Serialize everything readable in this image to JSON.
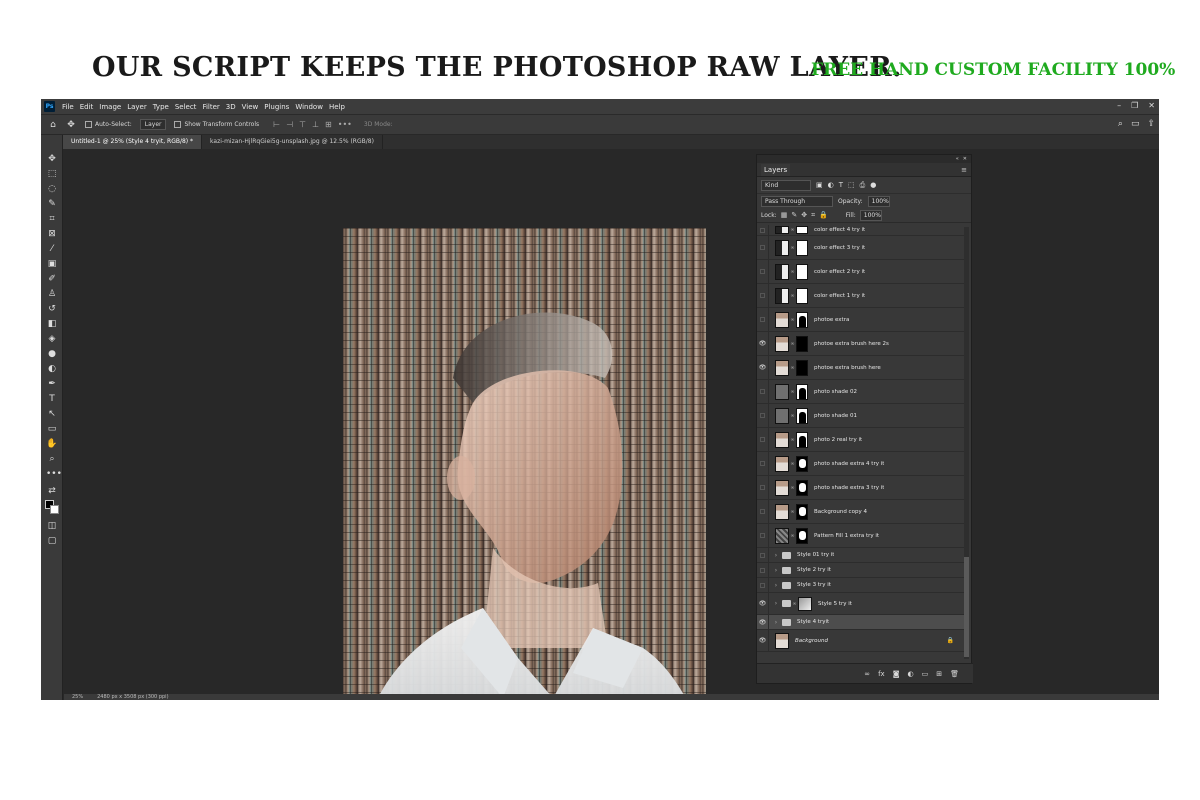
{
  "headline": "OUR SCRIPT KEEPS THE PHOTOSHOP RAW LAYER.",
  "tagline": "FREE HAND CUSTOM FACILITY 100%",
  "colors": {
    "tagline": "#1faa1f",
    "headline": "#1a1a1a",
    "ps_bg": "#282828"
  },
  "app": {
    "logo": "Ps",
    "menu": [
      "File",
      "Edit",
      "Image",
      "Layer",
      "Type",
      "Select",
      "Filter",
      "3D",
      "View",
      "Plugins",
      "Window",
      "Help"
    ],
    "window_controls": [
      "–",
      "❐",
      "✕"
    ]
  },
  "options": {
    "auto_select_label": "Auto-Select:",
    "auto_select_value": "Layer",
    "transform_label": "Show Transform Controls",
    "mode_3d": "3D Mode:"
  },
  "tabs": [
    "Untitled-1 @ 25% (Style 4 tryit, RGB/8) *",
    "kazi-mizan-HjlRqGiei5g-unsplash.jpg @ 12.5% (RGB/8)"
  ],
  "status": {
    "zoom": "25%",
    "size": "2480 px x 3508 px (300 ppi)"
  },
  "layers_panel": {
    "title": "Layers",
    "kind": "Kind",
    "blend_mode": "Pass Through",
    "opacity_label": "Opacity:",
    "opacity": "100%",
    "lock_label": "Lock:",
    "fill_label": "Fill:",
    "fill": "100%",
    "layers": [
      {
        "name": "color effect 4 try it",
        "kind": "adj-top"
      },
      {
        "name": "color effect 3 try it",
        "kind": "adj-cam"
      },
      {
        "name": "color effect 2 try it",
        "kind": "adj"
      },
      {
        "name": "color effect 1 try it",
        "kind": "adj"
      },
      {
        "name": "photoe extra",
        "kind": "photo-sil",
        "visible": false
      },
      {
        "name": "photoe extra brush here 2s",
        "kind": "photo-black",
        "visible": true
      },
      {
        "name": "photoe extra brush here",
        "kind": "photo-black",
        "visible": true
      },
      {
        "name": "photo shade 02",
        "kind": "gray-sil"
      },
      {
        "name": "photo shade 01",
        "kind": "gray-sil"
      },
      {
        "name": "photo 2 real try it",
        "kind": "photo-sil"
      },
      {
        "name": "photo shade extra 4 try it",
        "kind": "photo-portrait"
      },
      {
        "name": "photo shade extra 3 try it",
        "kind": "photo-portrait"
      },
      {
        "name": "Background copy 4",
        "kind": "photo-portrait"
      },
      {
        "name": "Pattern Fill 1 extra try it",
        "kind": "pattern"
      },
      {
        "name": "Style 01 try it",
        "kind": "group"
      },
      {
        "name": "Style 2 try it",
        "kind": "group"
      },
      {
        "name": "Style 3 try it",
        "kind": "group"
      },
      {
        "name": "Style 5 try it",
        "kind": "group-thumb",
        "visible": true
      },
      {
        "name": "Style 4 tryit",
        "kind": "group",
        "visible": true,
        "selected": true
      },
      {
        "name": "Background",
        "kind": "background",
        "visible": true
      }
    ],
    "footer_icons": [
      "link-icon",
      "fx-icon",
      "mask-icon",
      "adjustment-icon",
      "folder-icon",
      "new-layer-icon",
      "trash-icon"
    ]
  }
}
